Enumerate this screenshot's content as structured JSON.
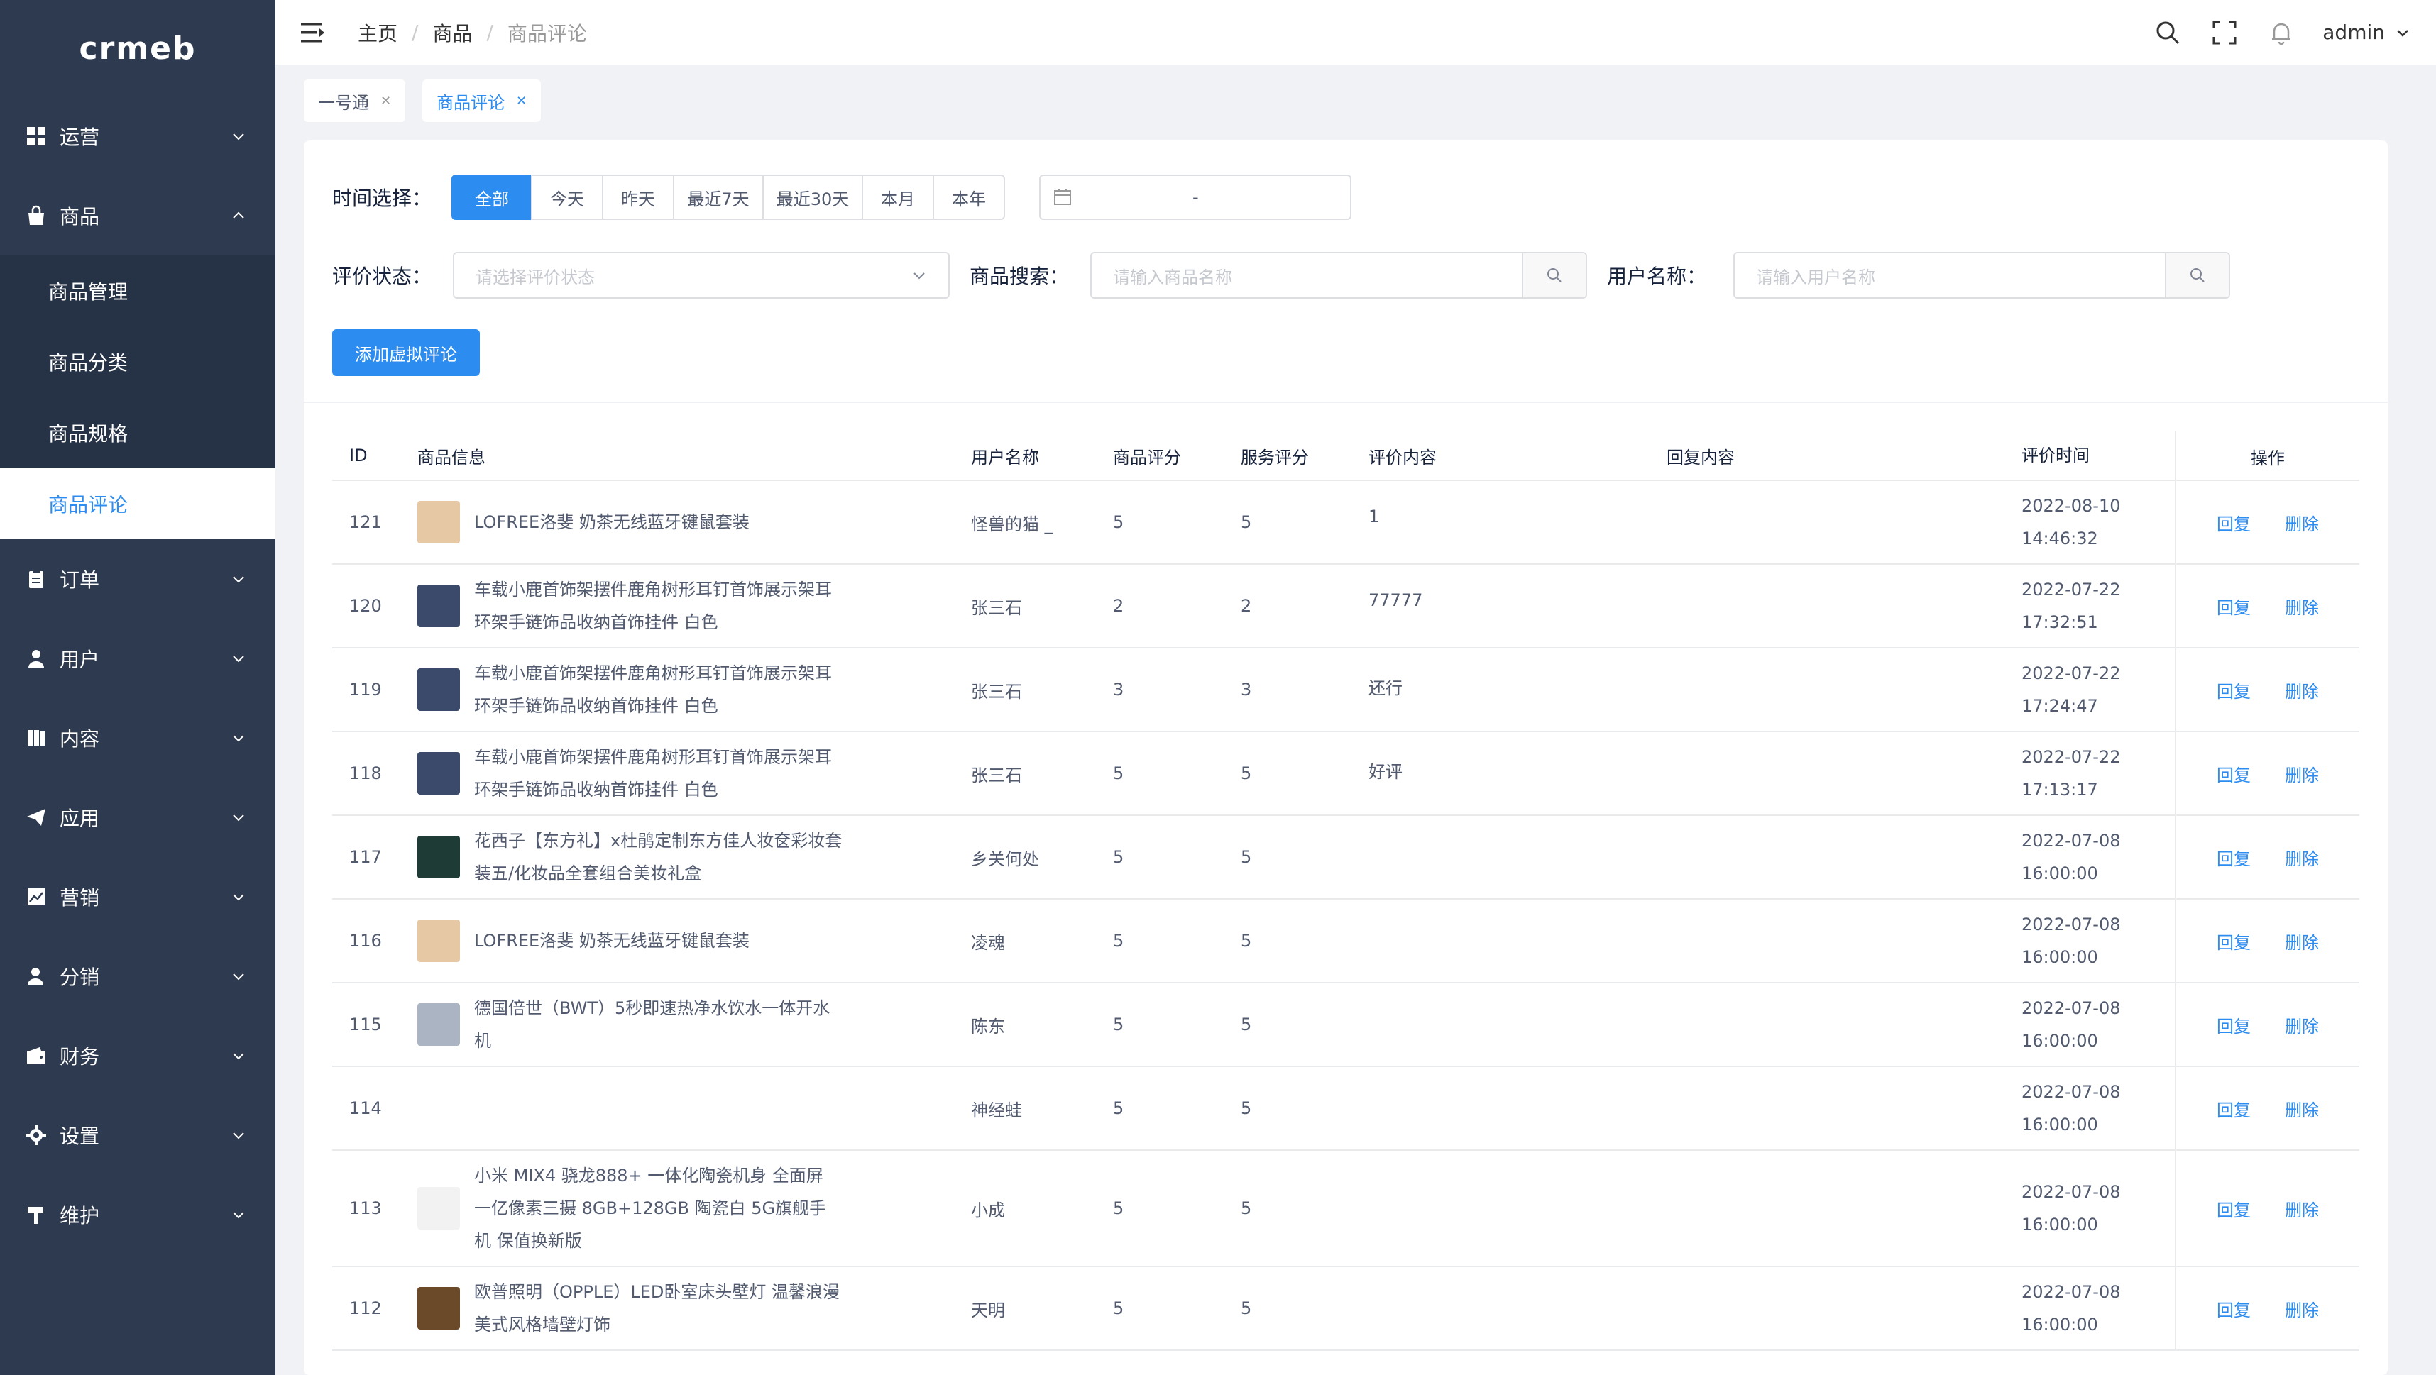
{
  "logo": "crmeb",
  "sidebar": {
    "items": [
      {
        "label": "运营",
        "icon": "grid-icon"
      },
      {
        "label": "商品",
        "icon": "shopping-bag-icon",
        "expanded": true,
        "children": [
          "商品管理",
          "商品分类",
          "商品规格",
          "商品评论"
        ],
        "active_child": "商品评论"
      },
      {
        "label": "订单",
        "icon": "clipboard-icon"
      },
      {
        "label": "用户",
        "icon": "user-icon"
      },
      {
        "label": "内容",
        "icon": "book-icon"
      },
      {
        "label": "应用",
        "icon": "paper-plane-icon"
      },
      {
        "label": "营销",
        "icon": "chart-icon"
      },
      {
        "label": "分销",
        "icon": "user-share-icon"
      },
      {
        "label": "财务",
        "icon": "wallet-icon"
      },
      {
        "label": "设置",
        "icon": "gear-icon"
      },
      {
        "label": "维护",
        "icon": "hammer-icon"
      }
    ]
  },
  "header": {
    "breadcrumb": [
      "主页",
      "商品",
      "商品评论"
    ],
    "user": "admin"
  },
  "tags": [
    {
      "label": "一号通",
      "active": false
    },
    {
      "label": "商品评论",
      "active": true
    }
  ],
  "filters": {
    "time_label": "时间选择：",
    "time_options": [
      "全部",
      "今天",
      "昨天",
      "最近7天",
      "最近30天",
      "本月",
      "本年"
    ],
    "time_selected": "全部",
    "date_range_sep": "-",
    "status_label": "评价状态：",
    "status_placeholder": "请选择评价状态",
    "product_search_label": "商品搜索：",
    "product_search_placeholder": "请输入商品名称",
    "username_label": "用户名称：",
    "username_placeholder": "请输入用户名称",
    "add_button": "添加虚拟评论"
  },
  "table": {
    "headers": {
      "id": "ID",
      "product": "商品信息",
      "user": "用户名称",
      "product_score": "商品评分",
      "service_score": "服务评分",
      "content": "评价内容",
      "reply": "回复内容",
      "time": "评价时间",
      "ops": "操作"
    },
    "reply_label": "回复",
    "delete_label": "删除",
    "rows": [
      {
        "id": "121",
        "product": "LOFREE洛斐 奶茶无线蓝牙键鼠套装",
        "thumb": "#e6c9a4",
        "user": "怪兽的猫 _",
        "product_score": "5",
        "service_score": "5",
        "content": "1",
        "time": "2022-08-10 14:46:32"
      },
      {
        "id": "120",
        "product": "车载小鹿首饰架摆件鹿角树形耳钉首饰展示架耳环架手链饰品收纳首饰挂件 白色",
        "thumb": "#3b4a6b",
        "user": "张三石",
        "product_score": "2",
        "service_score": "2",
        "content": "77777",
        "time": "2022-07-22 17:32:51"
      },
      {
        "id": "119",
        "product": "车载小鹿首饰架摆件鹿角树形耳钉首饰展示架耳环架手链饰品收纳首饰挂件 白色",
        "thumb": "#3b4a6b",
        "user": "张三石",
        "product_score": "3",
        "service_score": "3",
        "content": "还行",
        "time": "2022-07-22 17:24:47"
      },
      {
        "id": "118",
        "product": "车载小鹿首饰架摆件鹿角树形耳钉首饰展示架耳环架手链饰品收纳首饰挂件 白色",
        "thumb": "#3b4a6b",
        "user": "张三石",
        "product_score": "5",
        "service_score": "5",
        "content": "好评",
        "time": "2022-07-22 17:13:17"
      },
      {
        "id": "117",
        "product": "花西子【东方礼】x杜鹃定制东方佳人妆奁彩妆套装五/化妆品全套组合美妆礼盒",
        "thumb": "#1f3b36",
        "user": "乡关何处",
        "product_score": "5",
        "service_score": "5",
        "content": "",
        "time": "2022-07-08 16:00:00"
      },
      {
        "id": "116",
        "product": "LOFREE洛斐 奶茶无线蓝牙键鼠套装",
        "thumb": "#e6c9a4",
        "user": "凌魂",
        "product_score": "5",
        "service_score": "5",
        "content": "",
        "time": "2022-07-08 16:00:00"
      },
      {
        "id": "115",
        "product": "德国倍世（BWT）5秒即速热净水饮水一体开水机",
        "thumb": "#aab4c2",
        "user": "陈东",
        "product_score": "5",
        "service_score": "5",
        "content": "",
        "time": "2022-07-08 16:00:00"
      },
      {
        "id": "114",
        "product": "",
        "thumb": "",
        "user": "神经蛙",
        "product_score": "5",
        "service_score": "5",
        "content": "",
        "time": "2022-07-08 16:00:00"
      },
      {
        "id": "113",
        "product": "小米 MIX4 骁龙888+ 一体化陶瓷机身 全面屏 一亿像素三摄 8GB+128GB 陶瓷白 5G旗舰手机 保值换新版",
        "thumb": "#f2f2f2",
        "user": "小成",
        "product_score": "5",
        "service_score": "5",
        "content": "",
        "time": "2022-07-08 16:00:00"
      },
      {
        "id": "112",
        "product": "欧普照明（OPPLE）LED卧室床头壁灯 温馨浪漫美式风格墙壁灯饰",
        "thumb": "#6b4a2a",
        "user": "天明",
        "product_score": "5",
        "service_score": "5",
        "content": "",
        "time": "2022-07-08 16:00:00"
      }
    ]
  }
}
